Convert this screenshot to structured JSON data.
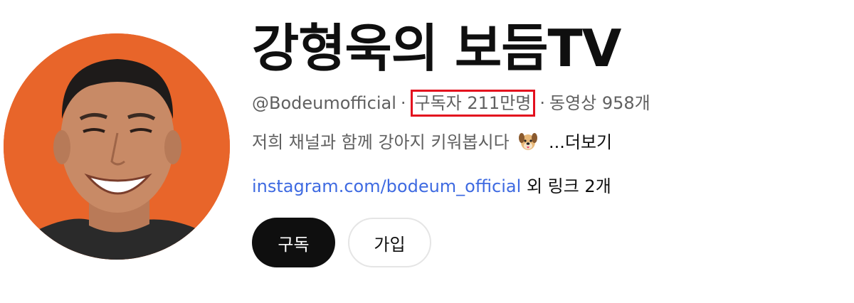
{
  "channel": {
    "name": "강형욱의 보듬TV",
    "handle": "@Bodeumofficial",
    "separator": "·",
    "subscribers": "구독자 211만명",
    "videos": "동영상 958개",
    "description": "저희 채널과 함께 강아지 키워봅시다",
    "description_emoji": "dog-face-icon",
    "more_label": "...더보기",
    "link_text": "instagram.com/bodeum_official",
    "other_links": "외 링크 2개"
  },
  "buttons": {
    "subscribe": "구독",
    "join": "가입"
  },
  "colors": {
    "avatar_bg": "#e8652a",
    "highlight_box": "#e3101e",
    "link": "#3e6ae1",
    "subscribe_bg": "#0f0f0f"
  }
}
